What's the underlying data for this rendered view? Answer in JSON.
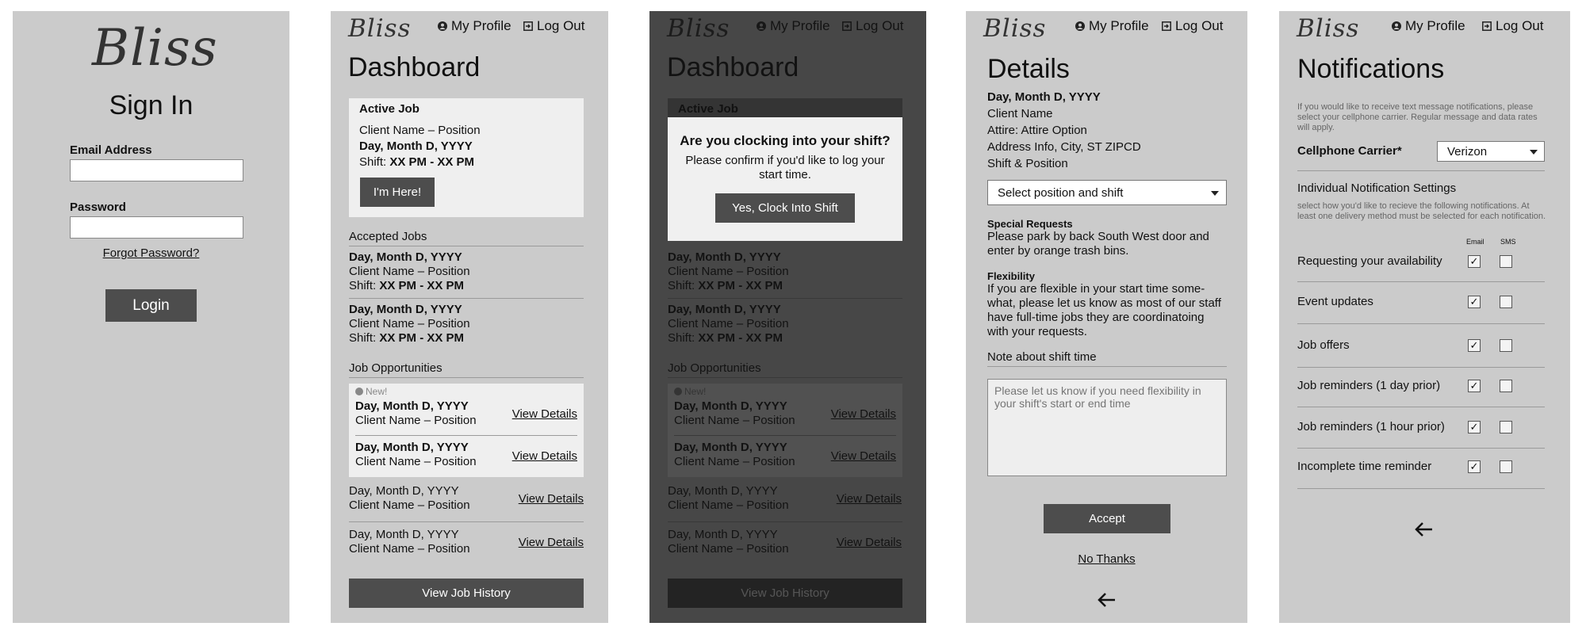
{
  "common": {
    "logo": "Bliss",
    "my_profile": "My Profile",
    "log_out": "Log Out"
  },
  "signin": {
    "title": "Sign In",
    "email_label": "Email Address",
    "email_value": "",
    "password_label": "Password",
    "password_value": "",
    "forgot": "Forgot Password?",
    "login": "Login"
  },
  "dashboard": {
    "title": "Dashboard",
    "active_job": {
      "heading": "Active Job",
      "client": "Client Name – Position",
      "date": "Day, Month D, YYYY",
      "shift_label": "Shift: ",
      "shift": "XX PM - XX PM",
      "button": "I'm Here!"
    },
    "accepted_heading": "Accepted Jobs",
    "accepted": [
      {
        "date": "Day, Month D, YYYY",
        "client": "Client Name – Position",
        "shift_label": "Shift: ",
        "shift": "XX PM - XX PM"
      },
      {
        "date": "Day, Month D, YYYY",
        "client": "Client Name – Position",
        "shift_label": "Shift: ",
        "shift": "XX PM - XX PM"
      }
    ],
    "opps_heading": "Job Opportunities",
    "new_badge": "New!",
    "new_opps": [
      {
        "date": "Day, Month D, YYYY",
        "client": "Client Name – Position",
        "link": "View Details"
      },
      {
        "date": "Day, Month D, YYYY",
        "client": "Client Name – Position",
        "link": "View Details"
      }
    ],
    "opps": [
      {
        "date": "Day, Month D, YYYY",
        "client": "Client Name – Position",
        "link": "View Details"
      },
      {
        "date": "Day, Month D, YYYY",
        "client": "Client Name – Position",
        "link": "View Details"
      }
    ],
    "history_button": "View Job History"
  },
  "modal": {
    "question": "Are you clocking into your shift?",
    "body": "Please confirm if you'd like to log your start time.",
    "button": "Yes, Clock Into Shift"
  },
  "details": {
    "title": "Details",
    "date": "Day, Month D, YYYY",
    "client": "Client Name",
    "attire": "Attire: Attire Option",
    "address": "Address Info, City, ST ZIPCD",
    "shift_position": "Shift & Position",
    "select": "Select position and shift",
    "special_heading": "Special Requests",
    "special_text": "Please park by back South West door and enter by orange trash bins.",
    "flex_heading": "Flexibility",
    "flex_text": "If you are flexible in your start time some-what, please let us know as most of our staff have full-time jobs they are coordinatoing with your requests.",
    "note_heading": "Note about shift time",
    "note_placeholder": "Please let us know if you need flexibility in your shift's start or end time",
    "accept": "Accept",
    "no_thanks": "No Thanks"
  },
  "notifications": {
    "title": "Notifications",
    "intro": "If you would like to receive text message notifications, please select your cellphone carrier. Regular message and data rates will apply.",
    "carrier_label": "Cellphone Carrier*",
    "carrier_value": "Verizon",
    "settings_heading": "Individual Notification Settings",
    "settings_desc": "select how you'd like to recieve the following notifications. At least one delivery method must be selected for each notification.",
    "col_email": "Email",
    "col_sms": "SMS",
    "items": [
      {
        "label": "Requesting your availability",
        "email": true,
        "sms": false
      },
      {
        "label": "Event updates",
        "email": true,
        "sms": false
      },
      {
        "label": "Job offers",
        "email": true,
        "sms": false
      },
      {
        "label": "Job reminders (1 day prior)",
        "email": true,
        "sms": false
      },
      {
        "label": "Job reminders (1 hour prior)",
        "email": true,
        "sms": false
      },
      {
        "label": "Incomplete time reminder",
        "email": true,
        "sms": false
      }
    ],
    "checkmark": "✓"
  }
}
